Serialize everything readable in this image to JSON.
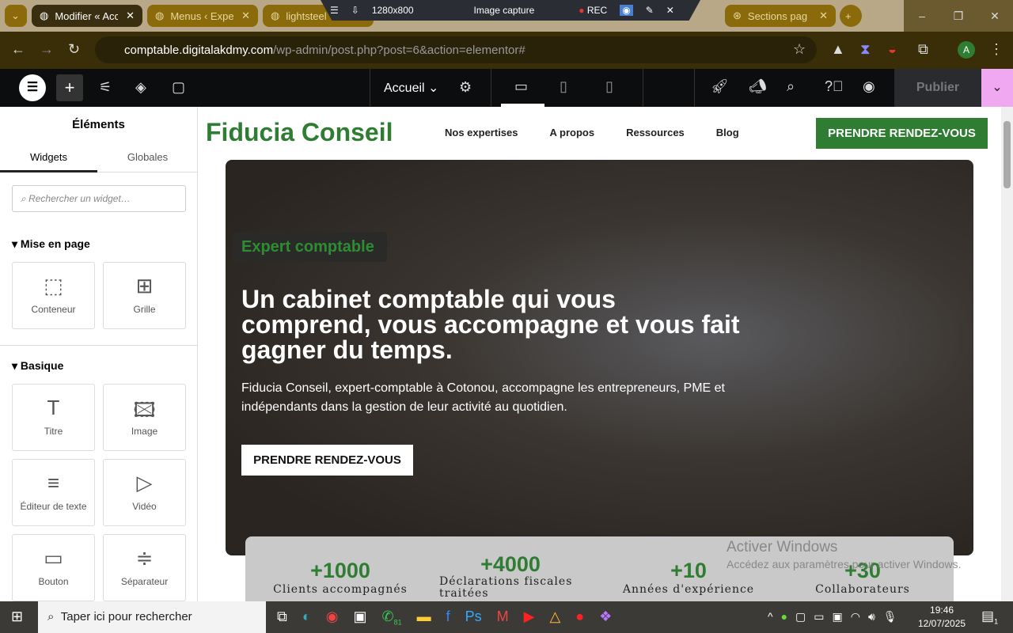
{
  "browser": {
    "tabs": [
      {
        "title": "Modifier « Accueil"
      },
      {
        "title": "Menus ‹ Expert"
      },
      {
        "title": "lightsteel"
      },
      {
        "title": "Sections page"
      }
    ],
    "capture_bar": {
      "size": "1280x800",
      "title": "Image capture",
      "rec": "REC"
    },
    "url_domain": "comptable.digitalakdmy.com",
    "url_path": "/wp-admin/post.php?post=6&action=elementor#",
    "profile": "A"
  },
  "editor": {
    "page_select": "Accueil",
    "publish": "Publier"
  },
  "panel": {
    "title": "Éléments",
    "tabs": [
      "Widgets",
      "Globales"
    ],
    "search_placeholder": "Rechercher un widget…",
    "sections": [
      {
        "title": "Mise en page",
        "widgets": [
          "Conteneur",
          "Grille"
        ]
      },
      {
        "title": "Basique",
        "widgets": [
          "Titre",
          "Image",
          "Éditeur de texte",
          "Vidéo",
          "Bouton",
          "Séparateur"
        ]
      }
    ]
  },
  "site": {
    "logo": "Fiducia Conseil",
    "nav": [
      "Nos expertises",
      "A propos",
      "Ressources",
      "Blog"
    ],
    "cta": "PRENDRE RENDEZ-VOUS",
    "hero": {
      "badge": "Expert comptable",
      "title": "Un cabinet comptable qui vous comprend, vous accompagne et vous fait gagner du temps.",
      "text": "Fiducia Conseil, expert-comptable à Cotonou, accompagne les entrepreneurs, PME et indépendants dans la gestion de leur activité au quotidien.",
      "button": "PRENDRE RENDEZ-VOUS"
    },
    "stats": [
      {
        "value": "+1000",
        "label": "Clients accompagnés"
      },
      {
        "value": "+4000",
        "label": "Déclarations fiscales traitées"
      },
      {
        "value": "+10",
        "label": "Années d'expérience"
      },
      {
        "value": "+30",
        "label": "Collaborateurs"
      }
    ]
  },
  "watermark": {
    "title": "Activer Windows",
    "sub": "Accédez aux paramètres pour activer Windows."
  },
  "taskbar": {
    "search": "Taper ici pour rechercher",
    "badge": "81",
    "time": "19:46",
    "date": "12/07/2025",
    "notif": "1"
  },
  "colors": {
    "brand": "#2e7d32",
    "accent": "#f0a8f0"
  }
}
